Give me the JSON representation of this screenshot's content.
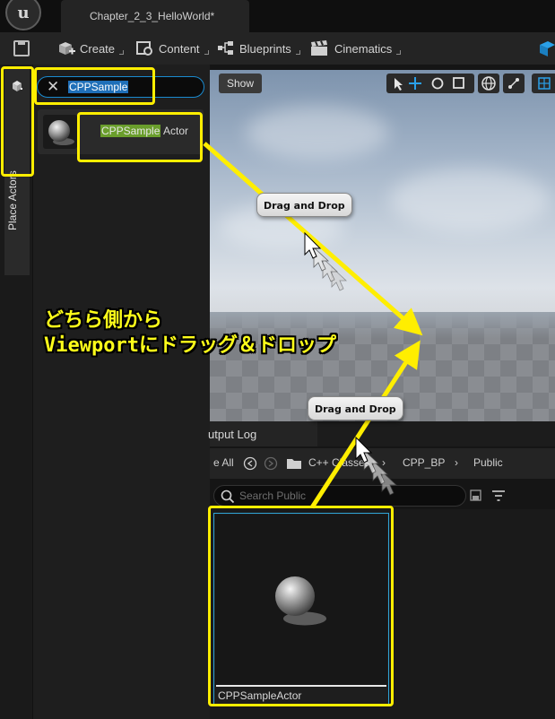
{
  "titlebar": {
    "tab_title": "Chapter_2_3_HelloWorld*"
  },
  "toolbar": {
    "create_label": "Create",
    "content_label": "Content",
    "blueprints_label": "Blueprints",
    "cinematics_label": "Cinematics"
  },
  "left_strip": {
    "place_actors_label": "Place Actors"
  },
  "place_actors": {
    "search_value": "CPPSample",
    "result": {
      "highlight": "CPPSample",
      "rest": " Actor"
    }
  },
  "viewport": {
    "show_label": "Show"
  },
  "bottom": {
    "output_log_tab": "utput Log",
    "breadcrumb": [
      "e All",
      "C++ Classes",
      "CPP_BP",
      "Public"
    ],
    "search_placeholder": "Search Public",
    "asset_name": "CPPSampleActor"
  },
  "annotations": {
    "tooltip_top": "Drag and Drop",
    "tooltip_bottom": "Drag and Drop",
    "callout_line1": "どちら側から",
    "callout_line2": "Viewportにドラッグ＆ドロップ",
    "highlight_color": "#ffee00"
  },
  "colors": {
    "accent_blue": "#1a8bd0",
    "search_highlight_green": "#6a9e2c",
    "tile_border": "#2fa4d7"
  }
}
